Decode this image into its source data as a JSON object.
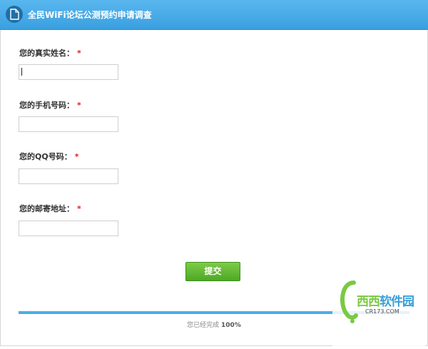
{
  "header": {
    "title": "全民WiFi论坛公测预约申请调查",
    "icon": "document-icon"
  },
  "form": {
    "fields": [
      {
        "label": "您的真实姓名：",
        "required_mark": "*",
        "value": ""
      },
      {
        "label": "您的手机号码：",
        "required_mark": "*",
        "value": ""
      },
      {
        "label": "您的QQ号码：",
        "required_mark": "*",
        "value": ""
      },
      {
        "label": "您的邮寄地址：",
        "required_mark": "*",
        "value": ""
      }
    ],
    "submit_label": "提交"
  },
  "progress": {
    "prefix": "您已经完成",
    "value_text": "100%",
    "fraction": 1.0
  },
  "watermark": {
    "brand": "西西软件园",
    "brand_part1": "西西",
    "brand_part2": "软件园",
    "url": "CR173.COM"
  },
  "colors": {
    "header": "#3a9fe0",
    "required": "#e02020",
    "submit": "#5bb52e",
    "progress": "#4aaee8"
  }
}
